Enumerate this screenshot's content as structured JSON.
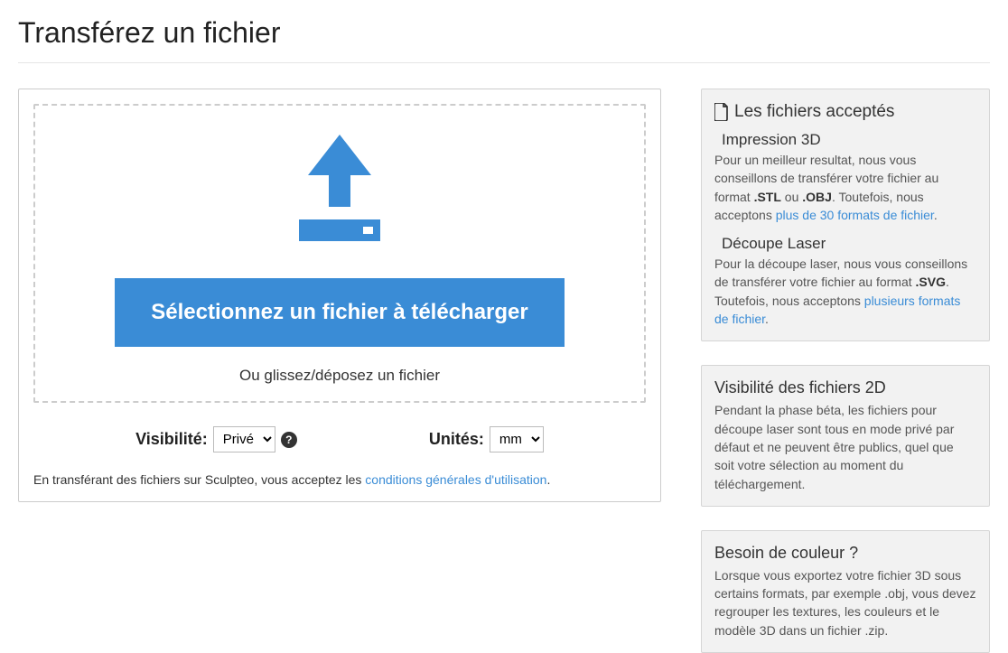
{
  "page": {
    "title": "Transférez un fichier"
  },
  "upload": {
    "button_label": "Sélectionnez un fichier à télécharger",
    "hint": "Ou glissez/déposez un fichier"
  },
  "options": {
    "visibility_label": "Visibilité:",
    "visibility_value": "Privé",
    "units_label": "Unités:",
    "units_value": "mm",
    "help_symbol": "?"
  },
  "tos": {
    "prefix": "En transférant des fichiers sur Sculpteo, vous acceptez les ",
    "link_text": "conditions générales d'utilisation",
    "suffix": "."
  },
  "sidebar": {
    "accepted": {
      "title": "Les fichiers acceptés",
      "section1": {
        "subtitle": "Impression 3D",
        "text_a": "Pour un meilleur resultat, nous vous conseillons de transférer votre fichier au format ",
        "fmt1": ".STL",
        "or": " ou ",
        "fmt2": ".OBJ",
        "text_b": ". Toutefois, nous acceptons ",
        "link": "plus de 30 formats de fichier",
        "dot": "."
      },
      "section2": {
        "subtitle": "Découpe Laser",
        "text_a": "Pour la découpe laser, nous vous conseillons de transférer votre fichier au format ",
        "fmt1": ".SVG",
        "text_b": ". Toutefois, nous acceptons ",
        "link": "plusieurs formats de fichier",
        "dot": "."
      }
    },
    "visibility2d": {
      "title": "Visibilité des fichiers 2D",
      "text": "Pendant la phase béta, les fichiers pour découpe laser sont tous en mode privé par défaut et ne peuvent être publics, quel que soit votre sélection au moment du téléchargement."
    },
    "color": {
      "title": "Besoin de couleur ?",
      "text": "Lorsque vous exportez votre fichier 3D sous certains formats, par exemple .obj, vous devez regrouper les textures, les couleurs et le modèle 3D dans un fichier .zip."
    }
  }
}
